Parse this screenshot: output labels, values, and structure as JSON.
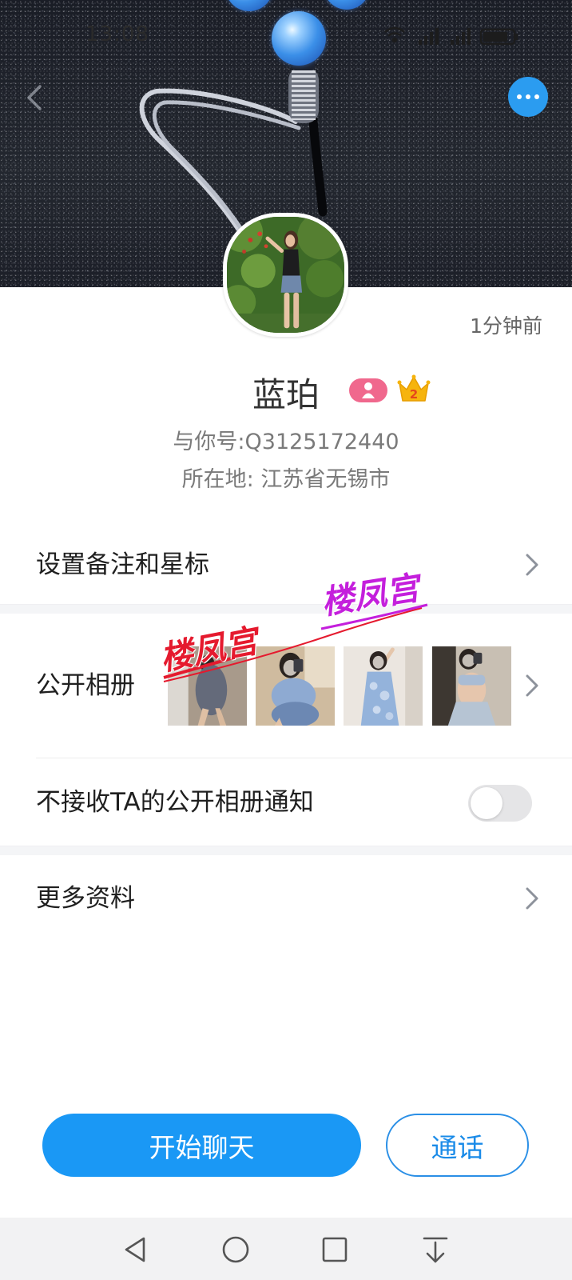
{
  "status_bar": {
    "time": "13:08",
    "icons": [
      "wifi-icon",
      "signal-icon",
      "battery-icon"
    ]
  },
  "header": {
    "back_icon": "chevron-left-icon",
    "more_icon": "more-dots-icon"
  },
  "profile": {
    "last_active": "1分钟前",
    "name": "蓝珀",
    "badges": [
      {
        "icon": "person-badge-icon",
        "color": "#f0688d"
      },
      {
        "icon": "crown-badge-icon",
        "level": "2",
        "color": "#f6b40e"
      }
    ],
    "account_id": "与你号:Q3125172440",
    "location": "所在地: 江苏省无锡市"
  },
  "settings": {
    "remark_row": {
      "label": "设置备注和星标",
      "icon": "chevron-right-icon"
    },
    "album_row": {
      "label": "公开相册",
      "icon": "chevron-right-icon",
      "watermarks": [
        "楼凤宫",
        "楼凤宫"
      ]
    },
    "notify_row": {
      "label": "不接收TA的公开相册通知",
      "toggle_on": false
    },
    "more_row": {
      "label": "更多资料",
      "icon": "chevron-right-icon"
    }
  },
  "actions": {
    "chat_label": "开始聊天",
    "call_label": "通话"
  },
  "nav_bar": {
    "icons": [
      "back-triangle-icon",
      "home-circle-icon",
      "recents-square-icon",
      "notification-shade-icon"
    ]
  },
  "colors": {
    "primary": "#1a98f5",
    "badge_pink": "#f0688d",
    "crown_gold": "#f6b40e",
    "watermark_red": "#e51a2e",
    "watermark_purple": "#c41fdc"
  }
}
